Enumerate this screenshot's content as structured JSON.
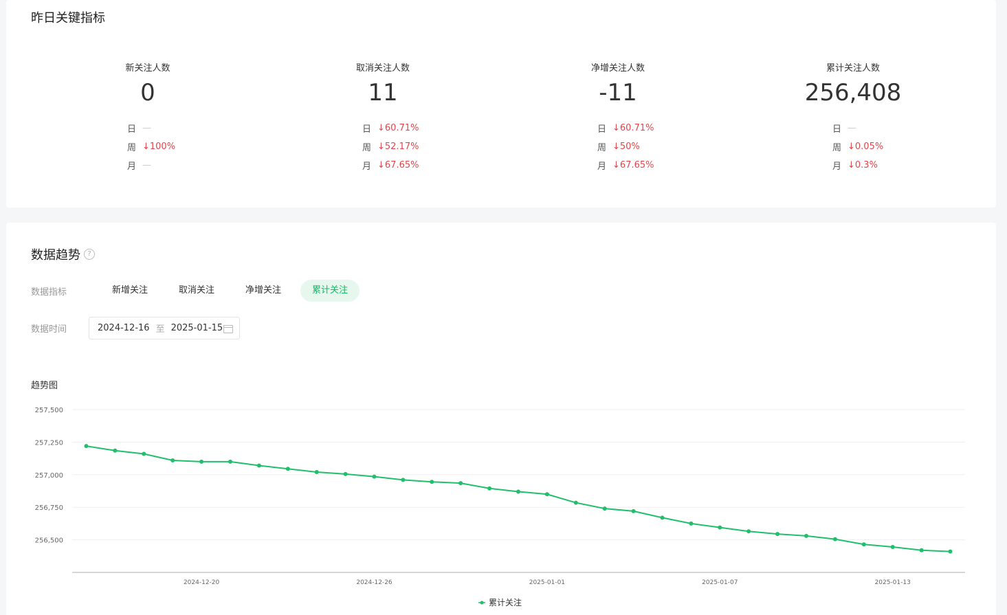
{
  "key_metrics": {
    "title": "昨日关键指标",
    "items": [
      {
        "label": "新关注人数",
        "value": "0",
        "comparisons": [
          {
            "name": "日",
            "value": "—",
            "trend": "none"
          },
          {
            "name": "周",
            "value": "↓100%",
            "trend": "down"
          },
          {
            "name": "月",
            "value": "—",
            "trend": "none"
          }
        ]
      },
      {
        "label": "取消关注人数",
        "value": "11",
        "comparisons": [
          {
            "name": "日",
            "value": "↓60.71%",
            "trend": "down"
          },
          {
            "name": "周",
            "value": "↓52.17%",
            "trend": "down"
          },
          {
            "name": "月",
            "value": "↓67.65%",
            "trend": "down"
          }
        ]
      },
      {
        "label": "净增关注人数",
        "value": "-11",
        "comparisons": [
          {
            "name": "日",
            "value": "↓60.71%",
            "trend": "down"
          },
          {
            "name": "周",
            "value": "↓50%",
            "trend": "down"
          },
          {
            "name": "月",
            "value": "↓67.65%",
            "trend": "down"
          }
        ]
      },
      {
        "label": "累计关注人数",
        "value": "256,408",
        "comparisons": [
          {
            "name": "日",
            "value": "—",
            "trend": "none"
          },
          {
            "name": "周",
            "value": "↓0.05%",
            "trend": "down"
          },
          {
            "name": "月",
            "value": "↓0.3%",
            "trend": "down"
          }
        ]
      }
    ]
  },
  "trend": {
    "title": "数据趋势",
    "help_icon": "?",
    "metric_filter_label": "数据指标",
    "metric_options": [
      {
        "label": "新增关注",
        "active": false
      },
      {
        "label": "取消关注",
        "active": false
      },
      {
        "label": "净增关注",
        "active": false
      },
      {
        "label": "累计关注",
        "active": true
      }
    ],
    "time_filter_label": "数据时间",
    "date_start": "2024-12-16",
    "date_separator": "至",
    "date_end": "2025-01-15",
    "chart_title": "趋势图"
  },
  "chart_data": {
    "type": "line",
    "x": [
      "2024-12-16",
      "2024-12-17",
      "2024-12-18",
      "2024-12-19",
      "2024-12-20",
      "2024-12-21",
      "2024-12-22",
      "2024-12-23",
      "2024-12-24",
      "2024-12-25",
      "2024-12-26",
      "2024-12-27",
      "2024-12-28",
      "2024-12-29",
      "2024-12-30",
      "2024-12-31",
      "2025-01-01",
      "2025-01-02",
      "2025-01-03",
      "2025-01-04",
      "2025-01-05",
      "2025-01-06",
      "2025-01-07",
      "2025-01-08",
      "2025-01-09",
      "2025-01-10",
      "2025-01-11",
      "2025-01-12",
      "2025-01-13",
      "2025-01-14",
      "2025-01-15"
    ],
    "x_ticks": [
      "2024-12-20",
      "2024-12-26",
      "2025-01-01",
      "2025-01-07",
      "2025-01-13"
    ],
    "series": [
      {
        "name": "累计关注",
        "color": "#1fbf6b",
        "values": [
          257220,
          257185,
          257160,
          257110,
          257100,
          257100,
          257070,
          257045,
          257020,
          257005,
          256985,
          256960,
          256945,
          256935,
          256895,
          256870,
          256850,
          256785,
          256740,
          256720,
          256670,
          256625,
          256595,
          256565,
          256545,
          256530,
          256505,
          256465,
          256445,
          256420,
          256410
        ]
      }
    ],
    "y_ticks": [
      "257,500",
      "257,250",
      "257,000",
      "256,750",
      "256,500"
    ],
    "ylim": [
      256250,
      257500
    ],
    "grid": true,
    "legend": "bottom-center"
  }
}
